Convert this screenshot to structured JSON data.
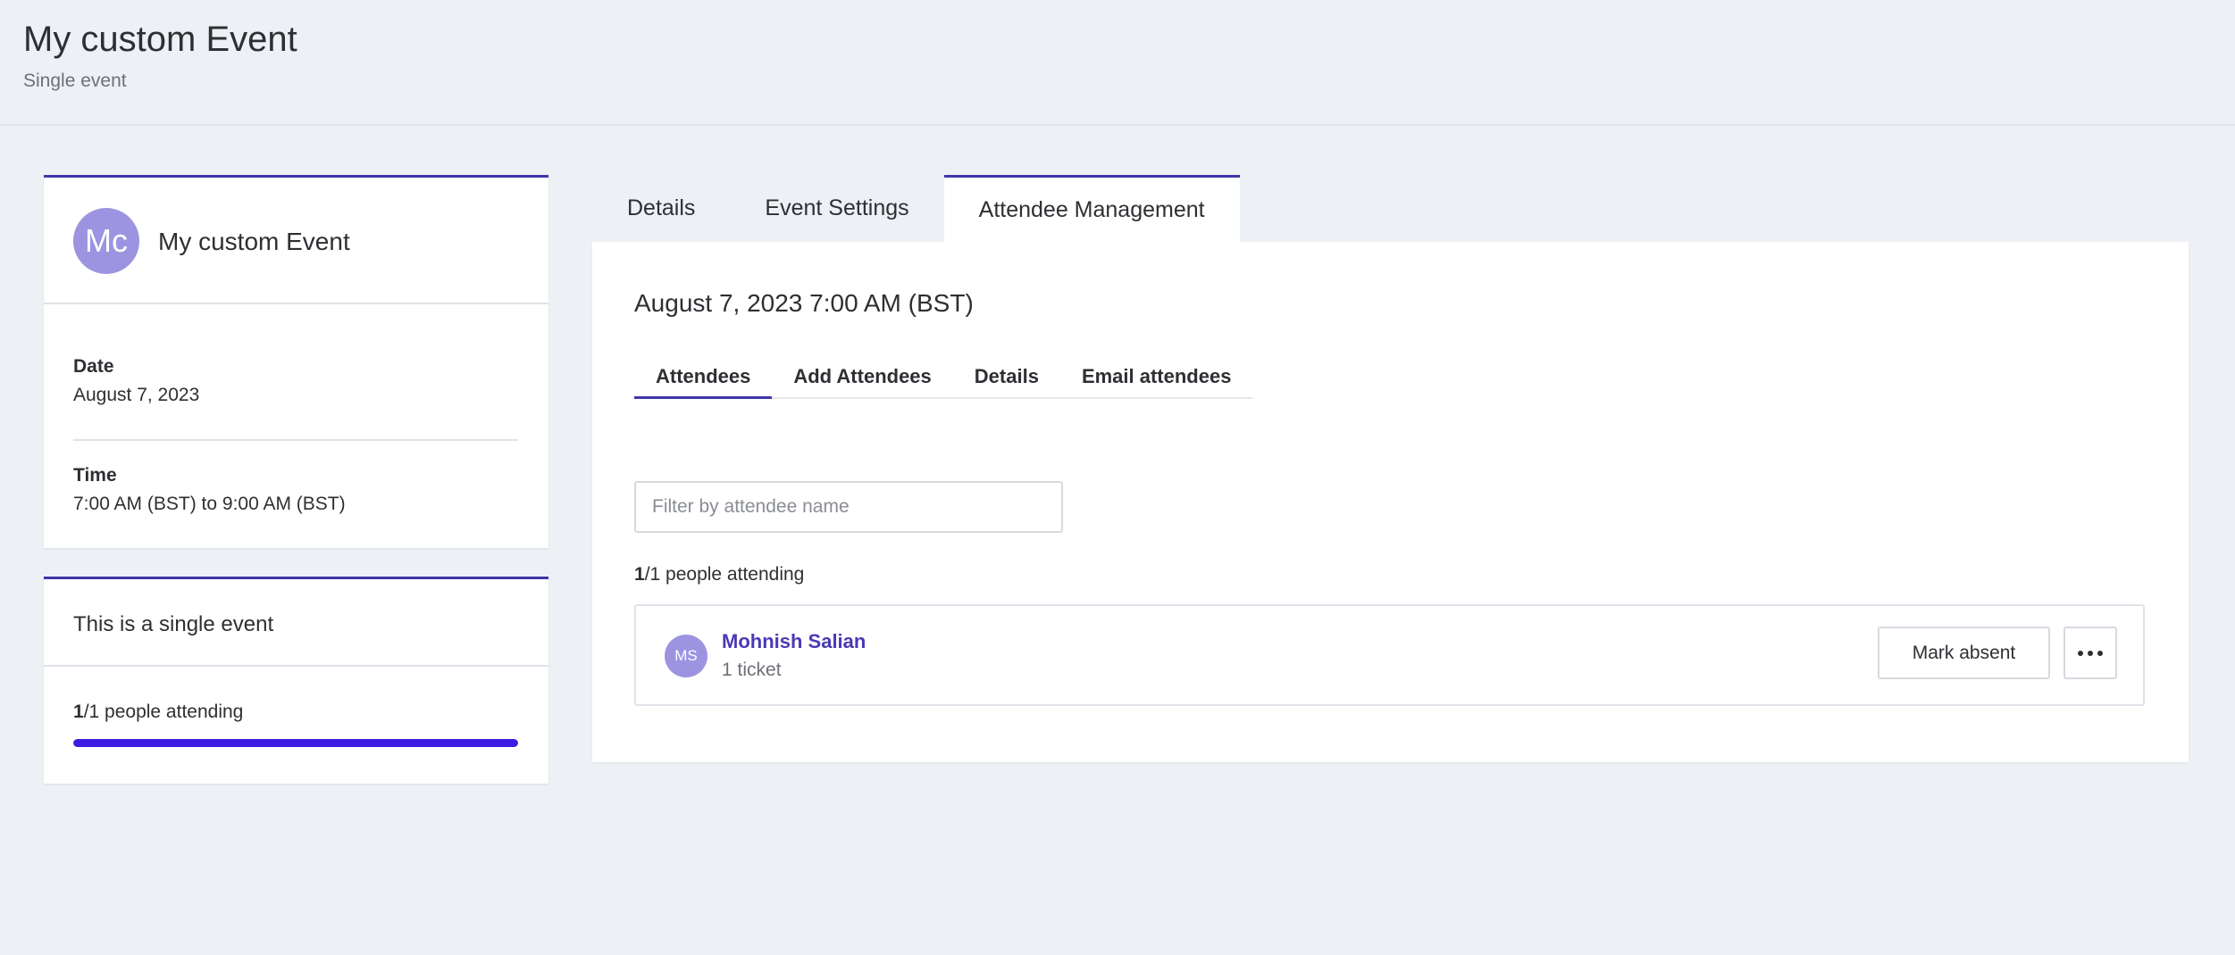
{
  "header": {
    "title": "My custom Event",
    "subtitle": "Single event"
  },
  "event_card": {
    "avatar_initials": "Mc",
    "title": "My custom Event",
    "date_label": "Date",
    "date_value": "August 7, 2023",
    "time_label": "Time",
    "time_value": "7:00 AM (BST) to 9:00 AM (BST)"
  },
  "summary_card": {
    "title": "This is a single event",
    "attending_count": "1",
    "attending_rest": "/1 people attending",
    "progress_fraction": 1.0
  },
  "main_tabs": [
    {
      "label": "Details"
    },
    {
      "label": "Event Settings"
    },
    {
      "label": "Attendee Management",
      "active": true
    }
  ],
  "panel": {
    "occurrence_title": "August 7, 2023 7:00 AM (BST)",
    "sub_tabs": [
      {
        "label": "Attendees",
        "active": true
      },
      {
        "label": "Add Attendees"
      },
      {
        "label": "Details"
      },
      {
        "label": "Email attendees"
      }
    ],
    "filter_placeholder": "Filter by attendee name",
    "attending_count": "1",
    "attending_rest": "/1 people attending",
    "attendees": [
      {
        "initials": "MS",
        "name": "Mohnish Salian",
        "tickets": "1 ticket",
        "action_label": "Mark absent",
        "more_icon": "more-horizontal-icon"
      }
    ]
  },
  "colors": {
    "accent": "#3f37a8",
    "progress": "#3d1ee0",
    "avatar": "#9c94e0",
    "link": "#4a39b5",
    "background": "#edf0f5"
  }
}
